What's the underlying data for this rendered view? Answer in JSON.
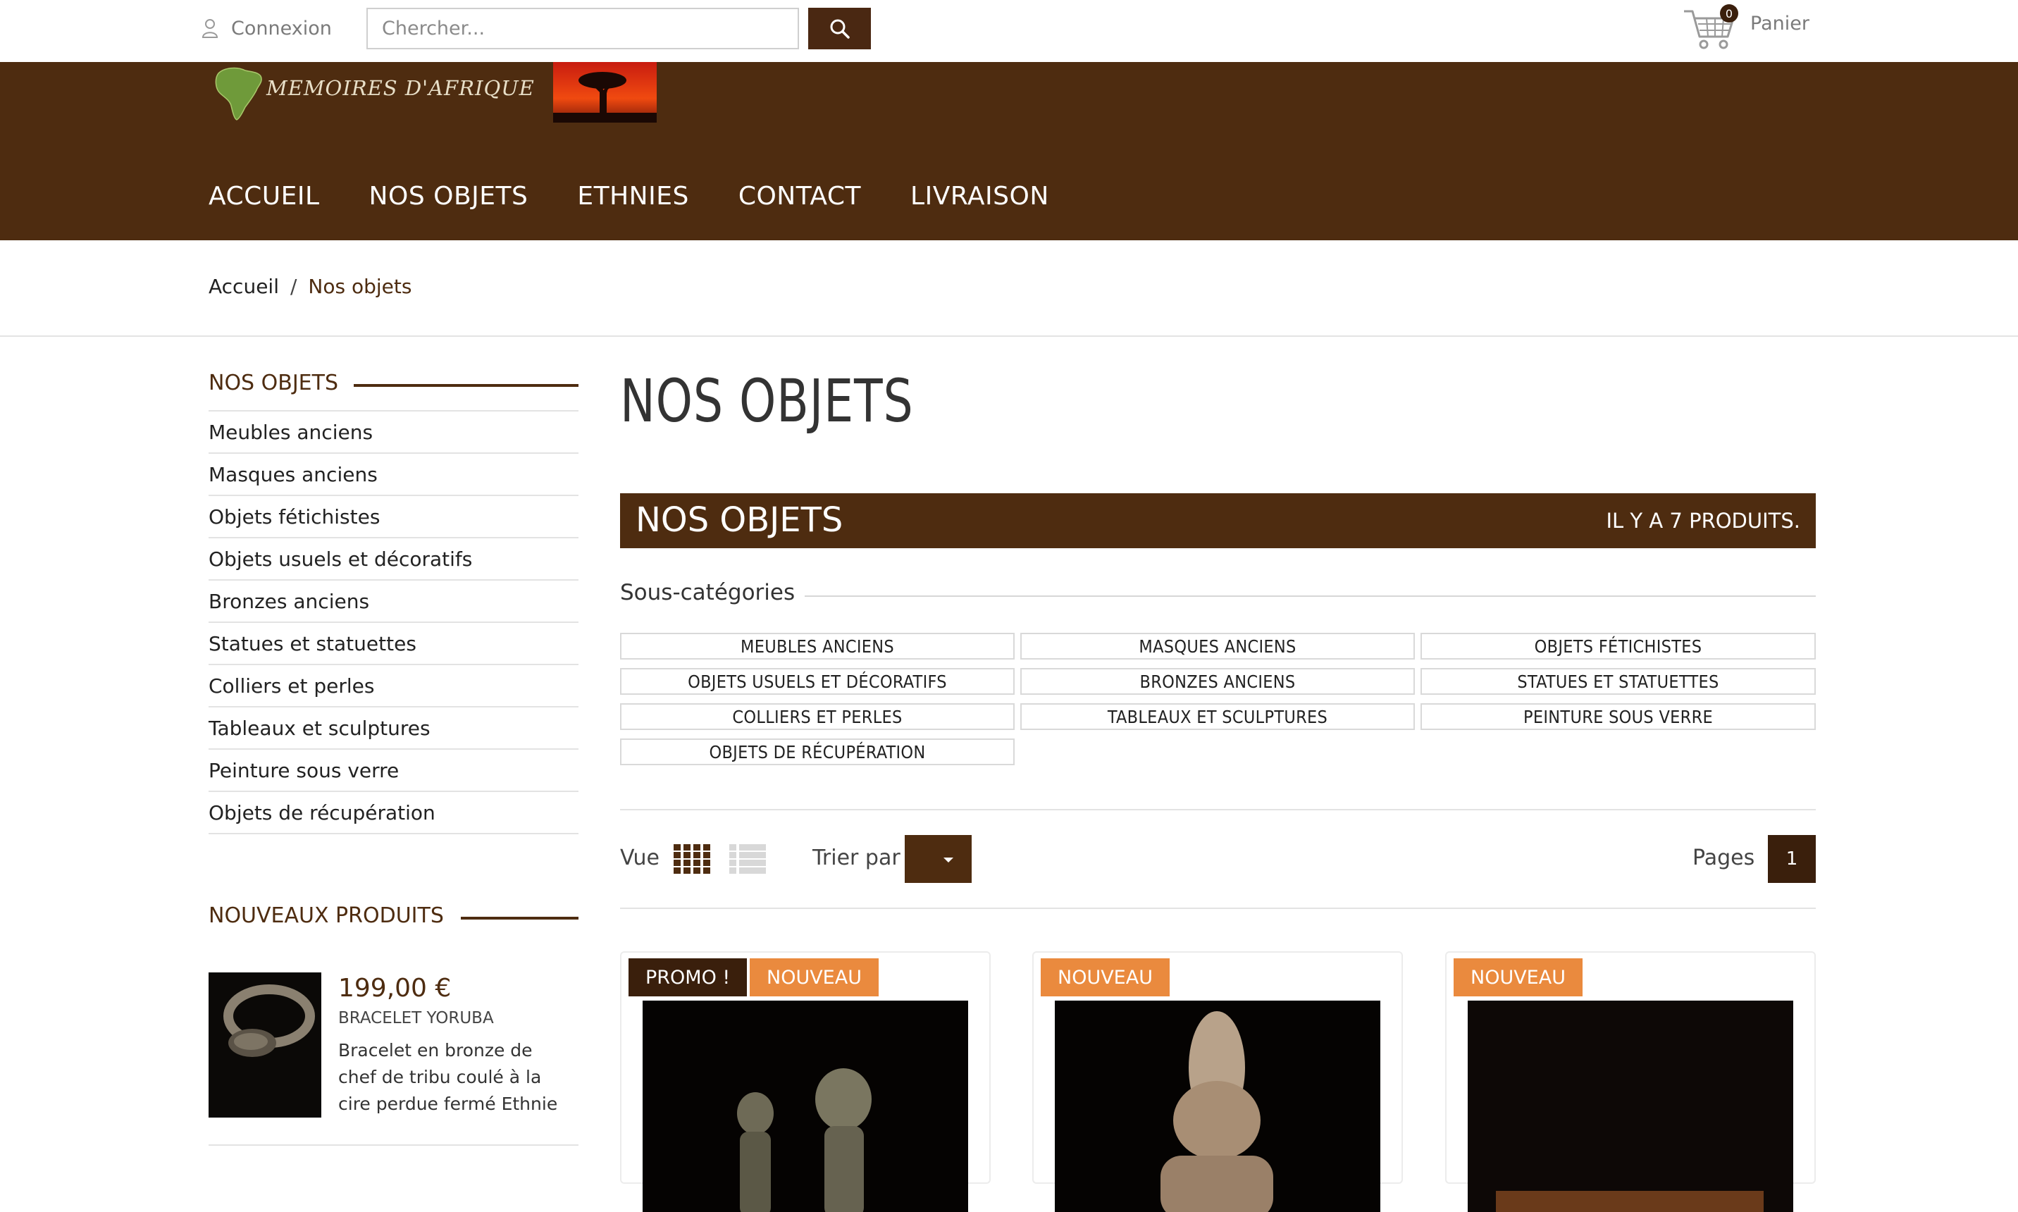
{
  "topbar": {
    "login_label": "Connexion",
    "search_placeholder": "Chercher...",
    "cart_count": "0",
    "cart_label": "Panier"
  },
  "brand": {
    "logo_text": "MEMOIRES D'AFRIQUE"
  },
  "nav": {
    "items": [
      "ACCUEIL",
      "NOS OBJETS",
      "ETHNIES",
      "CONTACT",
      "LIVRAISON"
    ]
  },
  "breadcrumb": {
    "home": "Accueil",
    "separator": "/",
    "current": "Nos objets"
  },
  "sidebar": {
    "title": "NOS OBJETS",
    "items": [
      "Meubles anciens",
      "Masques anciens",
      "Objets fétichistes",
      "Objets usuels et décoratifs",
      "Bronzes anciens",
      "Statues et statuettes",
      "Colliers et perles",
      "Tableaux et sculptures",
      "Peinture sous verre",
      "Objets de récupération"
    ],
    "new_products": {
      "title": "NOUVEAUX PRODUITS",
      "item": {
        "price": "199,00 €",
        "name": "BRACELET YORUBA",
        "description": "Bracelet en bronze de chef de tribu coulé à la cire perdue fermé Ethnie"
      }
    }
  },
  "main": {
    "page_title": "NOS OBJETS",
    "category_bar": {
      "title": "NOS OBJETS",
      "count": "IL Y A 7 PRODUITS."
    },
    "subcategories_label": "Sous-catégories",
    "subcategories": [
      "MEUBLES ANCIENS",
      "MASQUES ANCIENS",
      "OBJETS FÉTICHISTES",
      "OBJETS USUELS ET DÉCORATIFS",
      "BRONZES ANCIENS",
      "STATUES ET STATUETTES",
      "COLLIERS ET PERLES",
      "TABLEAUX ET SCULPTURES",
      "PEINTURE SOUS VERRE",
      "OBJETS DE RÉCUPÉRATION"
    ],
    "toolbar": {
      "view_label": "Vue",
      "sort_label": "Trier par",
      "pages_label": "Pages",
      "current_page": "1"
    },
    "products": [
      {
        "badges": [
          "PROMO !",
          "NOUVEAU"
        ]
      },
      {
        "badges": [
          "NOUVEAU"
        ]
      },
      {
        "badges": [
          "NOUVEAU"
        ]
      }
    ]
  },
  "colors": {
    "brand_brown": "#4e2c10",
    "dark_brown": "#3a1f0c",
    "badge_orange": "#ea8a3e"
  }
}
